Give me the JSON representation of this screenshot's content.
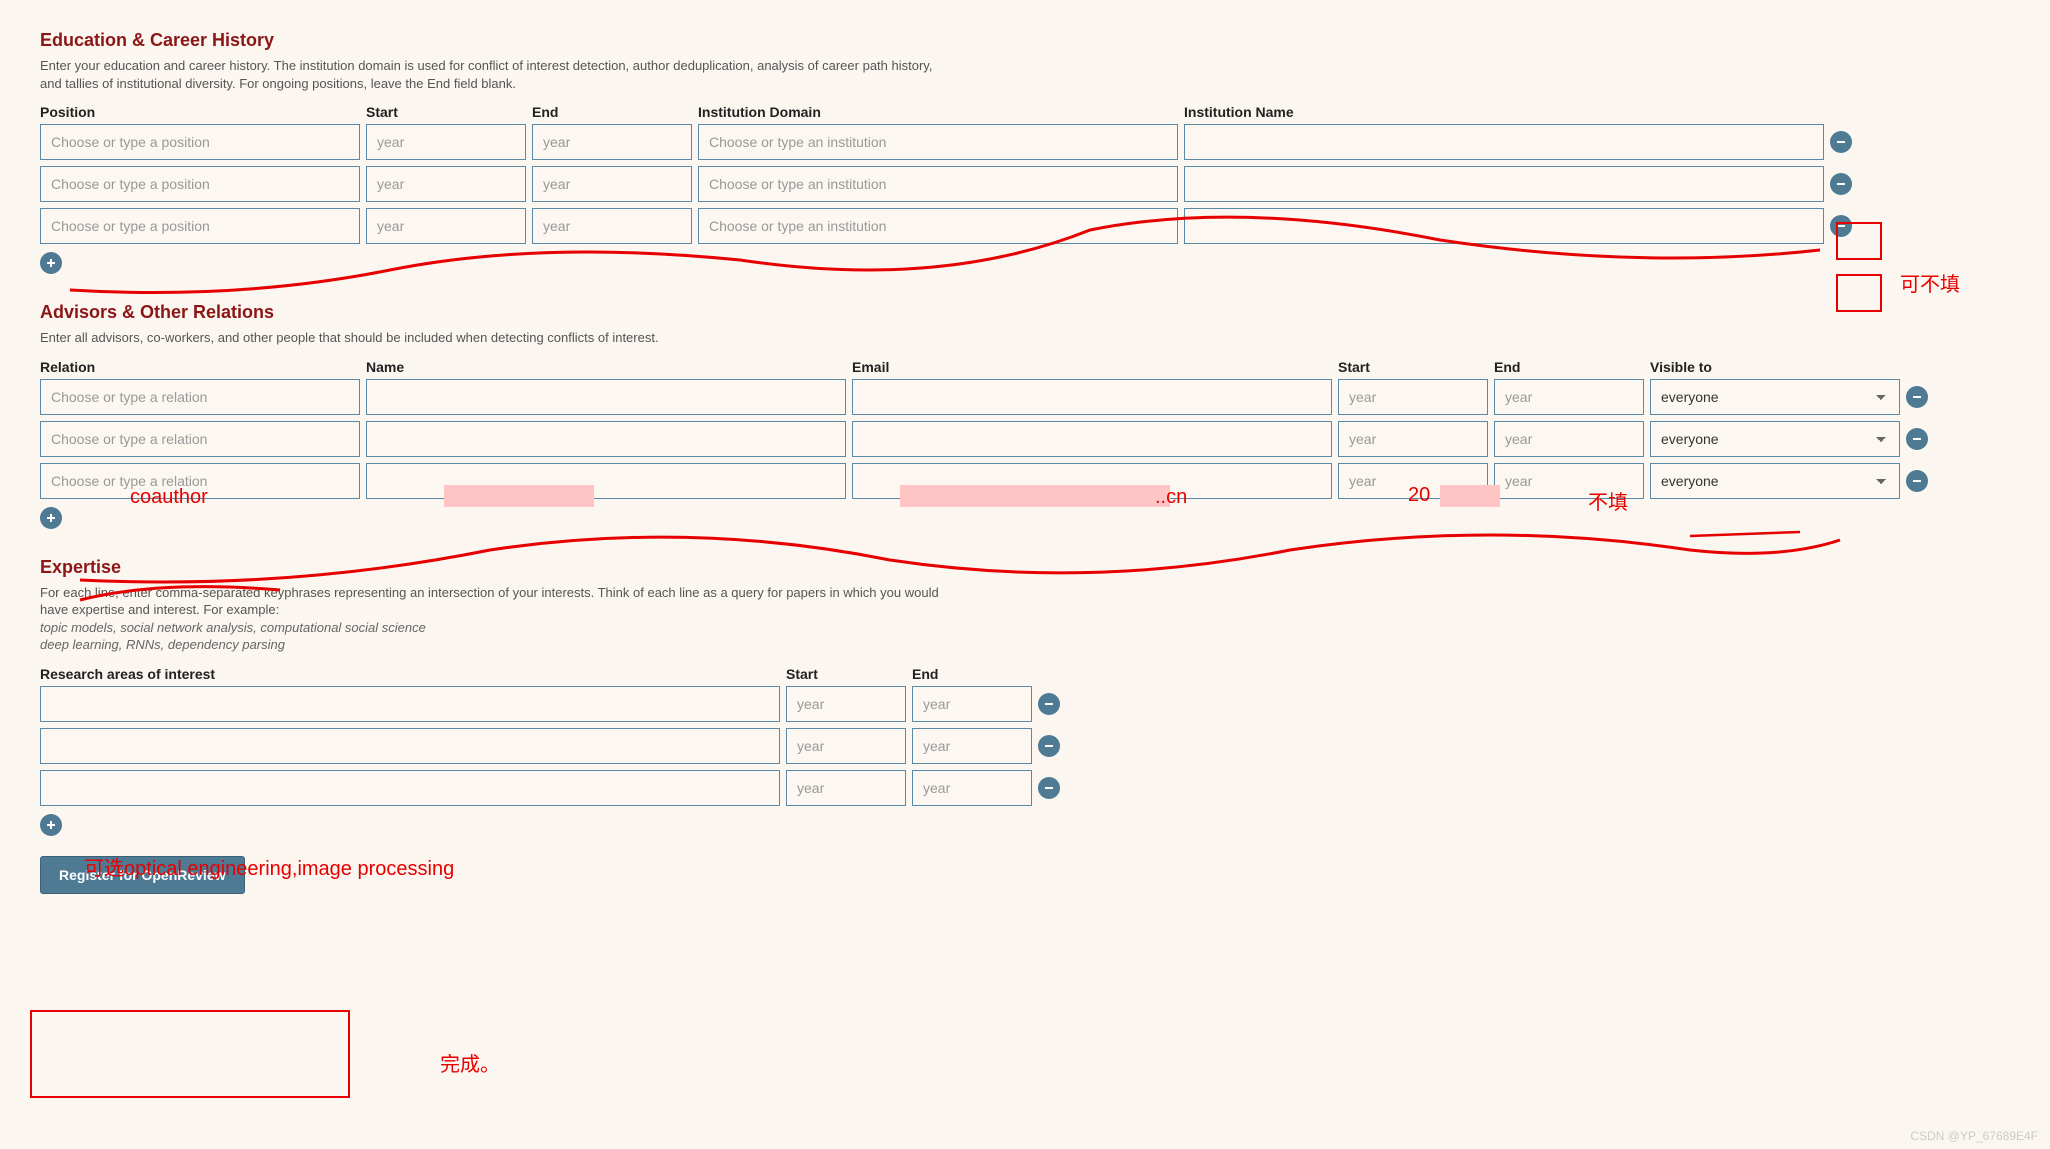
{
  "education": {
    "title": "Education & Career History",
    "desc": "Enter your education and career history. The institution domain is used for conflict of interest detection, author deduplication, analysis of career path history, and tallies of institutional diversity. For ongoing positions, leave the End field blank.",
    "headers": {
      "position": "Position",
      "start": "Start",
      "end": "End",
      "domain": "Institution Domain",
      "name": "Institution Name"
    },
    "placeholders": {
      "position": "Choose or type a position",
      "year": "year",
      "domain": "Choose or type an institution"
    },
    "rows": [
      {
        "position": "",
        "start": "",
        "end": "",
        "domain": "",
        "name": ""
      },
      {
        "position": "",
        "start": "",
        "end": "",
        "domain": "",
        "name": ""
      },
      {
        "position": "",
        "start": "",
        "end": "",
        "domain": "",
        "name": ""
      }
    ]
  },
  "advisors": {
    "title": "Advisors & Other Relations",
    "desc": "Enter all advisors, co-workers, and other people that should be included when detecting conflicts of interest.",
    "headers": {
      "relation": "Relation",
      "name": "Name",
      "email": "Email",
      "start": "Start",
      "end": "End",
      "visible": "Visible to"
    },
    "placeholders": {
      "relation": "Choose or type a relation",
      "year": "year"
    },
    "visible_option": "everyone",
    "rows": [
      {
        "relation": "",
        "name": "",
        "email": "..cn",
        "start": "",
        "end": ""
      },
      {
        "relation": "",
        "name": "",
        "email": "",
        "start": "",
        "end": ""
      },
      {
        "relation": "",
        "name": "",
        "email": "",
        "start": "",
        "end": ""
      }
    ]
  },
  "expertise": {
    "title": "Expertise",
    "desc": "For each line, enter comma-separated keyphrases representing an intersection of your interests. Think of each line as a query for papers in which you would have expertise and interest. For example:",
    "example1": "topic models, social network analysis, computational social science",
    "example2": "deep learning, RNNs, dependency parsing",
    "headers": {
      "research": "Research areas of interest",
      "start": "Start",
      "end": "End"
    },
    "placeholders": {
      "year": "year"
    },
    "rows": [
      {
        "research": "",
        "start": "",
        "end": ""
      },
      {
        "research": "",
        "start": "",
        "end": ""
      },
      {
        "research": "",
        "start": "",
        "end": ""
      }
    ]
  },
  "register_label": "Register for OpenReview",
  "annotations": {
    "optional": "可不填",
    "coauthor": "coauthor",
    "year20": "20",
    "nofill": "不填",
    "optional_expertise": "可选optical engineering,image processing",
    "done": "完成。"
  },
  "watermark": "CSDN @YP_67689E4F"
}
